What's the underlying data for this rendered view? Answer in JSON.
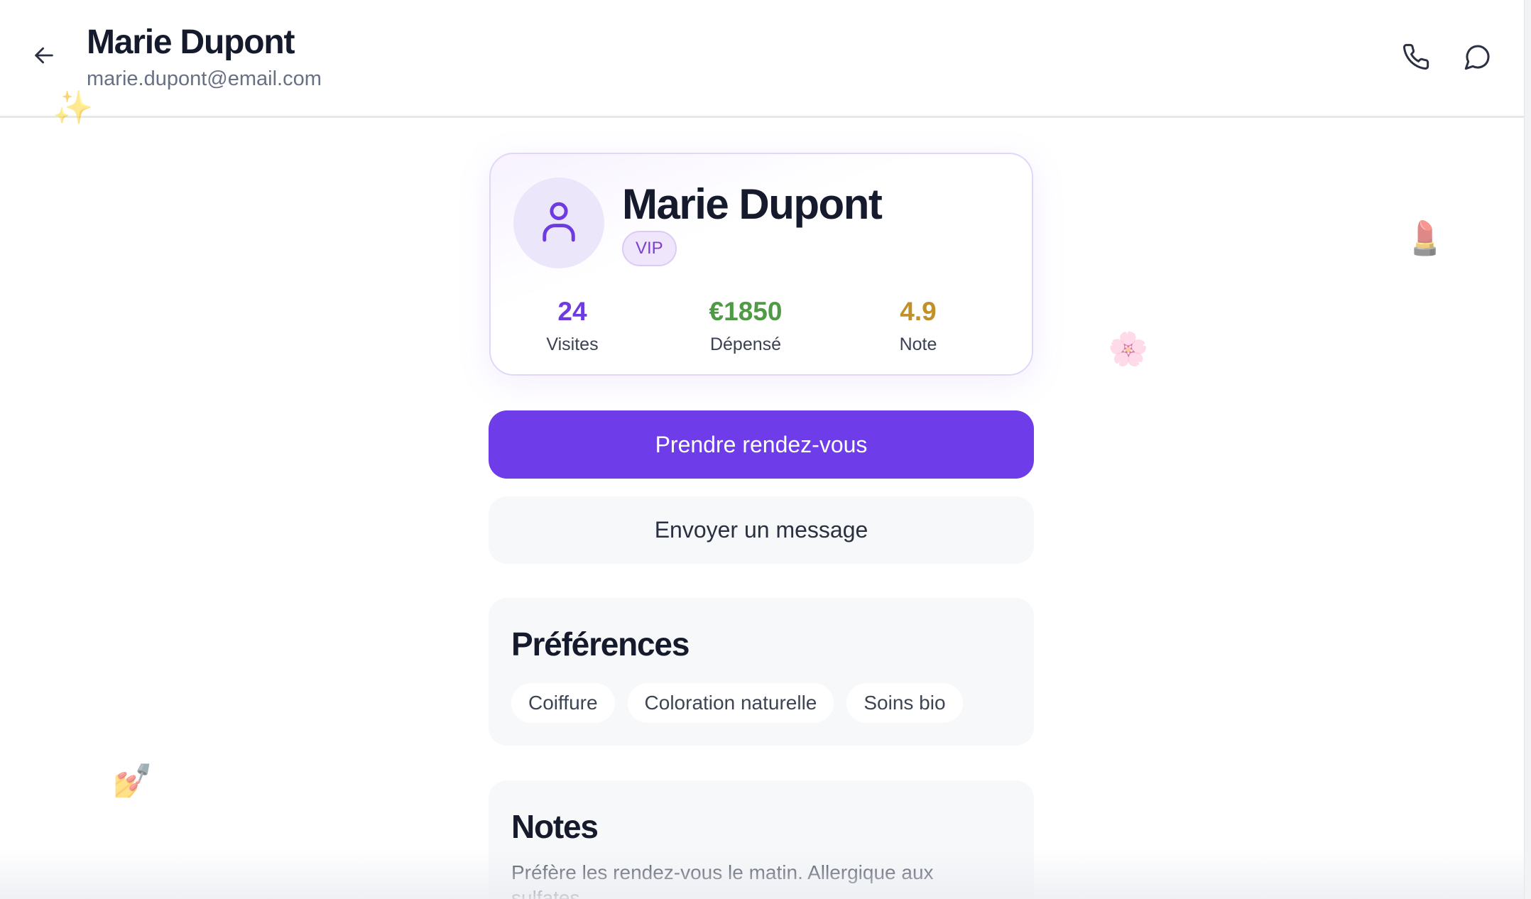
{
  "header": {
    "title": "Marie Dupont",
    "subtitle": "marie.dupont@email.com",
    "back_icon": "arrow-left-icon",
    "phone_icon": "phone-icon",
    "chat_icon": "message-circle-icon"
  },
  "decorations": {
    "sparkles": "✨",
    "lipstick": "💄",
    "flower": "🌸",
    "nail_polish": "💅"
  },
  "profile": {
    "avatar_icon": "user-icon",
    "name": "Marie Dupont",
    "badge": "VIP",
    "stats": [
      {
        "value": "24",
        "label": "Visites",
        "color": "#6d3be0"
      },
      {
        "value": "€1850",
        "label": "Dépensé",
        "color": "#4f9a45"
      },
      {
        "value": "4.9",
        "label": "Note",
        "color": "#c0902a"
      }
    ]
  },
  "actions": {
    "primary": "Prendre rendez-vous",
    "secondary": "Envoyer un message",
    "primary_color": "#6e3ce9"
  },
  "preferences": {
    "title": "Préférences",
    "items": [
      "Coiffure",
      "Coloration naturelle",
      "Soins bio"
    ]
  },
  "notes": {
    "title": "Notes",
    "text": "Préfère les rendez-vous le matin. Allergique aux sulfates."
  }
}
